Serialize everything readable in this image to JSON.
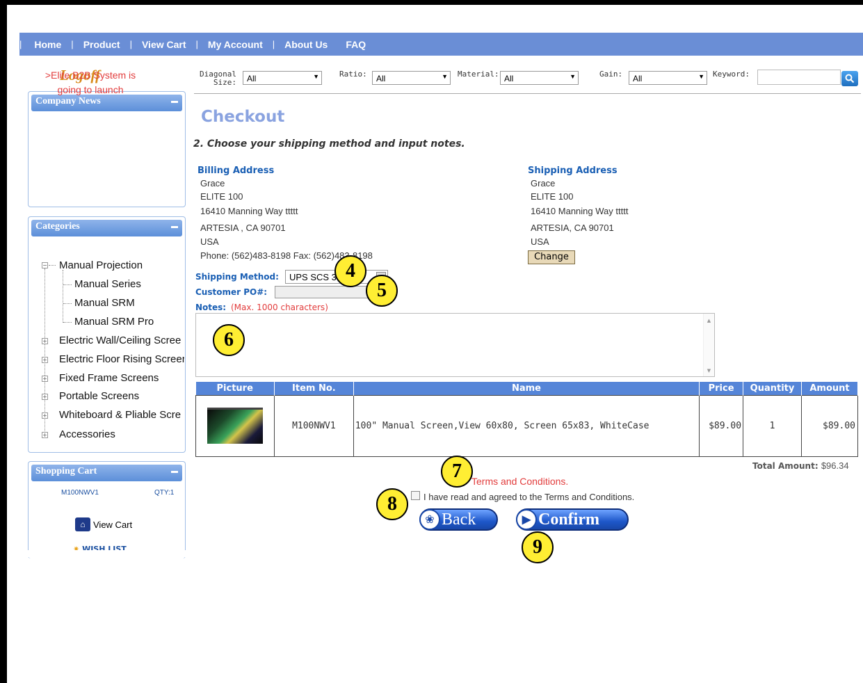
{
  "nav": {
    "lead": "|",
    "items": [
      "Home",
      "Product",
      "View Cart",
      "My Account",
      "About Us",
      "FAQ"
    ],
    "separator": "|"
  },
  "logoff": "Logoff",
  "filters": {
    "diagonal_label_1": "Diagonal",
    "diagonal_label_2": "Size:",
    "diagonal_value": "All",
    "ratio_label": "Ratio:",
    "ratio_value": "All",
    "material_label": "Material:",
    "material_value": "All",
    "gain_label": "Gain:",
    "gain_value": "All",
    "keyword_label": "Keyword:",
    "keyword_value": ""
  },
  "sidebar": {
    "news_title": "Company News",
    "news_text": ">Elite B2B System is going to launch",
    "categories_title": "Categories",
    "categories": [
      {
        "label": "Manual Projection",
        "expanded": true
      },
      {
        "label": "Manual Series"
      },
      {
        "label": "Manual SRM"
      },
      {
        "label": "Manual SRM Pro"
      },
      {
        "label": "Electric Wall/Ceiling Scree"
      },
      {
        "label": "Electric Floor Rising Screer"
      },
      {
        "label": "Fixed Frame Screens"
      },
      {
        "label": "Portable Screens"
      },
      {
        "label": "Whiteboard & Pliable Scre"
      },
      {
        "label": "Accessories"
      }
    ],
    "cart_title": "Shopping Cart",
    "cart_item": "M100NWV1",
    "cart_qty": "QTY:1",
    "view_cart": "View Cart",
    "wish_list": "WISH LIST"
  },
  "main": {
    "title": "Checkout",
    "step": "2. Choose your shipping method and input notes.",
    "billing": {
      "heading": "Billing Address",
      "lines": [
        "Grace",
        "ELITE 100",
        "16410 Manning Way ttttt",
        "ARTESIA , CA 90701",
        "USA",
        "Phone: (562)483-8198 Fax: (562)483-8198"
      ]
    },
    "shipping": {
      "heading": "Shipping Address",
      "lines": [
        "Grace",
        "ELITE 100",
        "16410 Manning Way ttttt",
        "ARTESIA, CA 90701",
        "USA"
      ],
      "change_label": "Change"
    },
    "shipping_method_label": "Shipping Method:",
    "shipping_method_value": "UPS SCS 3",
    "customer_po_label": "Customer PO#:",
    "notes_label": "Notes:",
    "notes_hint": "(Max. 1000 characters)",
    "table": {
      "headers": [
        "Picture",
        "Item No.",
        "Name",
        "Price",
        "Quantity",
        "Amount"
      ],
      "rows": [
        {
          "item_no": "M100NWV1",
          "name": "100\" Manual Screen,View 60x80, Screen 65x83, WhiteCase",
          "price": "$89.00",
          "quantity": "1",
          "amount": "$89.00"
        }
      ]
    },
    "total_label": "Total Amount:",
    "total_value": "$96.34",
    "terms_link": "Terms and Conditions.",
    "agree_text": "I have read and agreed to the Terms and Conditions.",
    "back_label": "Back",
    "confirm_label": "Confirm"
  },
  "callouts": [
    "4",
    "5",
    "6",
    "7",
    "8",
    "9"
  ],
  "colors": {
    "nav": "#6a8ed6",
    "callout": "#ffee33",
    "accent_red": "#e23c3c",
    "link_blue": "#1a5fb4"
  }
}
